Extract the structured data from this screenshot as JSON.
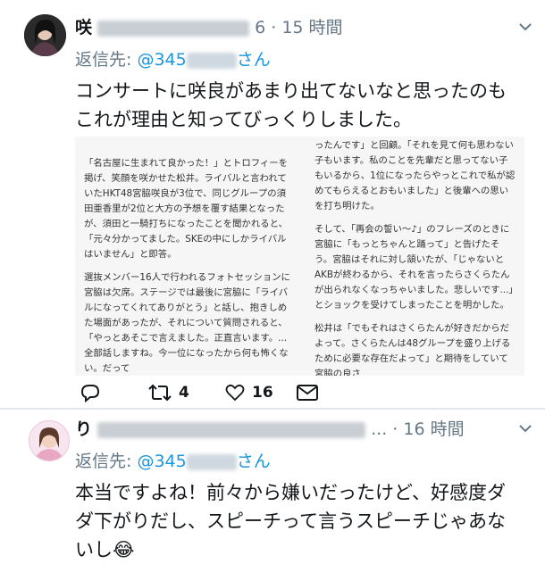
{
  "tweets": [
    {
      "name_visible": "咲",
      "name_suffix": "6",
      "time": "· 15 時間",
      "reply_prefix": "返信先:",
      "reply_handle": "@345",
      "reply_suffix": "さん",
      "text": "コンサートに咲良があまり出てないなと思ったのもこれが理由と知ってびっくりしました。",
      "article": {
        "left_paragraphs": [
          "「名古屋に生まれて良かった！」とトロフィーを掲げ、笑顔を咲かせた松井。ライバルと言われていたHKT48宮脇咲良が3位で、同じグループの須田亜香里が2位と大方の予想を覆す結果となったが、須田と一騎打ちになったことを聞かれると、「元々分かってました。SKEの中にしかライバルはいません」と即答。",
          "選抜メンバー16人で行われるフォトセッションに宮脇は欠席。ステージでは最後に宮脇に「ライバルになってくれてありがとう」と話し、抱きしめた場面があったが、それについて質問されると、「やっとあそこで言えました。正直言います。...全部話しますね。今一位になったから何も怖くない。だって"
        ],
        "right_paragraphs": [
          "ったんです」と回顧。「それを見て何も思わない子もいます。私のことを先輩だと思ってない子もいるから、1位になったらやっとこれで私が認めてもらえるとおもいました」と後輩への思いを打ち明けた。",
          "そして、「再会の誓い〜♪」のフレーズのときに宮脇に「もっとちゃんと踊って」と告げたそう。宮脇はそれに対し頷いたが、「じゃないとAKBが終わるから、それを言ったらさくらたんが出られなくなっちゃいました。悲しいです...」とショックを受けてしまったことを明かした。",
          "松井は「でもそれはさくらたんが好きだからだよって。さくらたんは48グループを盛り上げるために必要な存在だよって」と期待をしていて宮脇の良さ"
        ]
      },
      "actions": {
        "reply_count": "",
        "retweet_count": "4",
        "like_count": "16"
      }
    },
    {
      "name_visible": "り",
      "name_suffix": "...",
      "time": "· 16 時間",
      "reply_prefix": "返信先:",
      "reply_handle": "@345",
      "reply_suffix": "さん",
      "text": "本当ですよね！前々から嫌いだったけど、好感度ダダ下がりだし、スピーチって言うスピーチじゃあないし😂"
    }
  ],
  "colors": {
    "link": "#1b95e0",
    "secondary": "#657786",
    "text": "#14171a",
    "divider": "#e1e8ed"
  },
  "icons": [
    "reply-icon",
    "retweet-icon",
    "like-icon",
    "direct-message-icon",
    "chevron-down-icon"
  ]
}
